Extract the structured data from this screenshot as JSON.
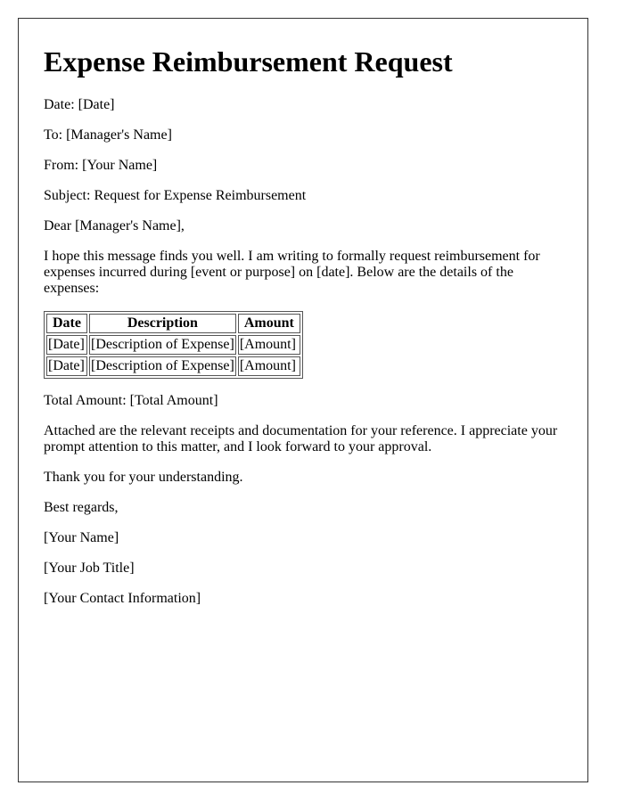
{
  "document": {
    "title": "Expense Reimbursement Request",
    "date_line": "Date: [Date]",
    "to_line": "To: [Manager's Name]",
    "from_line": "From: [Your Name]",
    "subject_line": "Subject: Request for Expense Reimbursement",
    "salutation": "Dear [Manager's Name],",
    "intro": "I hope this message finds you well. I am writing to formally request reimbursement for expenses incurred during [event or purpose] on [date]. Below are the details of the expenses:",
    "table": {
      "headers": [
        "Date",
        "Description",
        "Amount"
      ],
      "rows": [
        [
          "[Date]",
          "[Description of Expense]",
          "[Amount]"
        ],
        [
          "[Date]",
          "[Description of Expense]",
          "[Amount]"
        ]
      ]
    },
    "total_line": "Total Amount: [Total Amount]",
    "closing_paragraph": "Attached are the relevant receipts and documentation for your reference. I appreciate your prompt attention to this matter, and I look forward to your approval.",
    "thanks": "Thank you for your understanding.",
    "sign_off": "Best regards,",
    "signature_name": "[Your Name]",
    "signature_title": "[Your Job Title]",
    "signature_contact": "[Your Contact Information]"
  }
}
